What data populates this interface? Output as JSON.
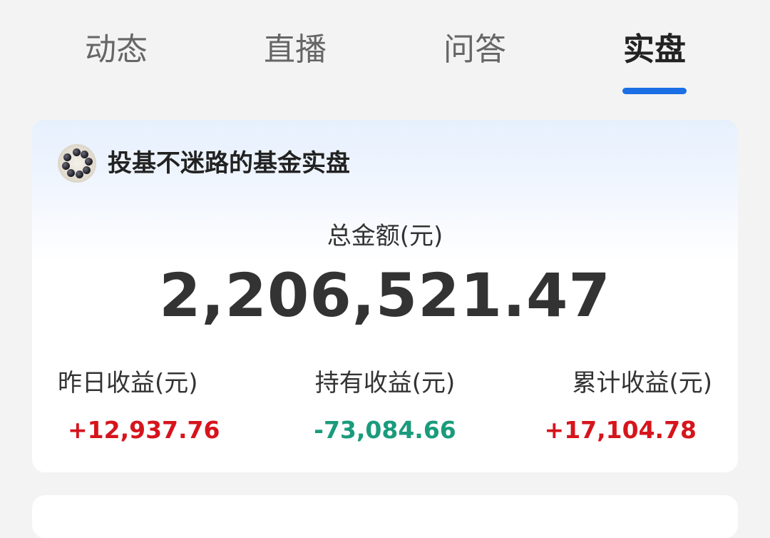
{
  "tabs": [
    {
      "label": "动态",
      "active": false
    },
    {
      "label": "直播",
      "active": false
    },
    {
      "label": "问答",
      "active": false
    },
    {
      "label": "实盘",
      "active": true
    }
  ],
  "card": {
    "title": "投基不迷路的基金实盘",
    "avatar_icon": "bead-bracelet-avatar",
    "total_label": "总金额(元)",
    "total_value": "2,206,521.47",
    "stats": [
      {
        "label": "昨日收益(元)",
        "value": "+12,937.76",
        "color": "#d6141c"
      },
      {
        "label": "持有收益(元)",
        "value": "-73,084.66",
        "color": "#1a9b7c"
      },
      {
        "label": "累计收益(元)",
        "value": "+17,104.78",
        "color": "#d6141c"
      }
    ]
  },
  "colors": {
    "accent": "#1b6fe4",
    "positive": "#d6141c",
    "negative": "#1a9b7c"
  }
}
